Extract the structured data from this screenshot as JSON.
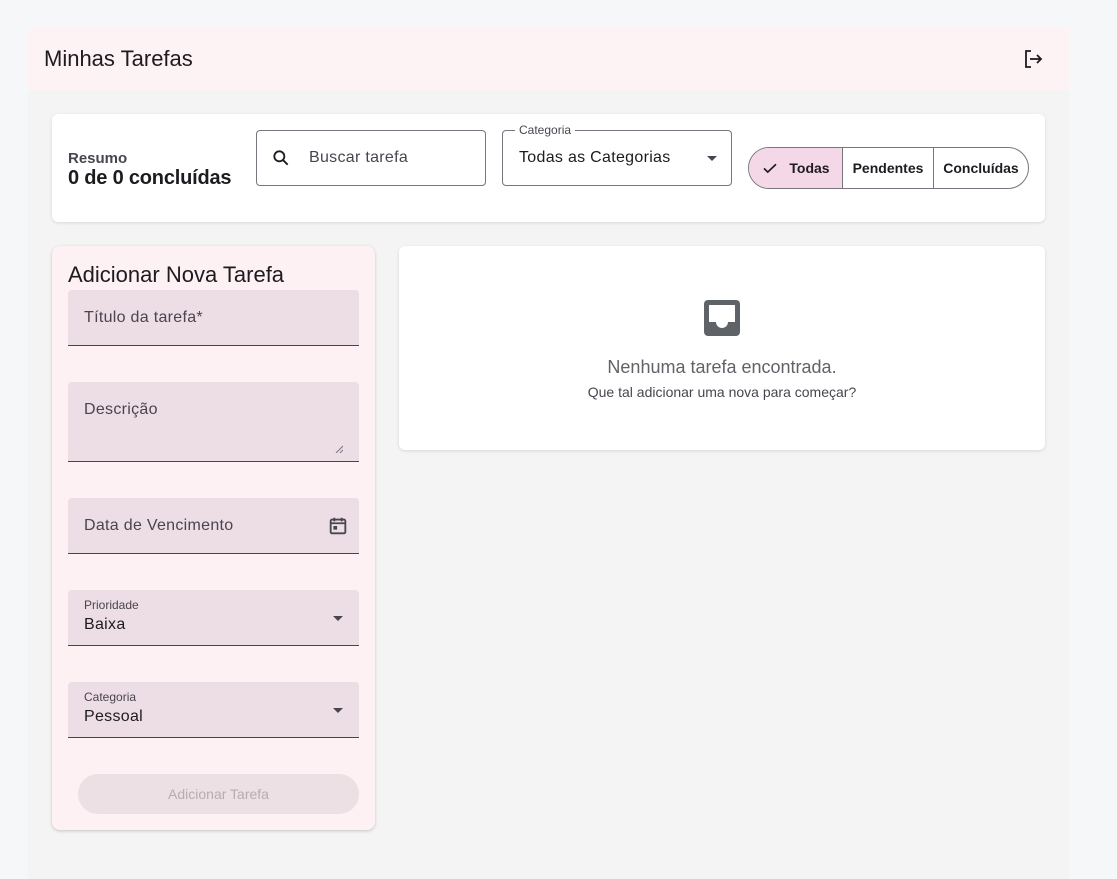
{
  "appbar": {
    "title": "Minhas Tarefas",
    "logout_icon": "logout-icon"
  },
  "summary": {
    "label": "Resumo",
    "value": "0 de 0 concluídas"
  },
  "search": {
    "placeholder": "Buscar tarefa",
    "value": ""
  },
  "category_filter": {
    "label": "Categoria",
    "selected": "Todas as Categorias"
  },
  "status_filter": {
    "options": [
      {
        "label": "Todas",
        "selected": true
      },
      {
        "label": "Pendentes",
        "selected": false
      },
      {
        "label": "Concluídas",
        "selected": false
      }
    ]
  },
  "new_task_form": {
    "title": "Adicionar Nova Tarefa",
    "title_field": {
      "placeholder": "Título da tarefa*"
    },
    "description_field": {
      "placeholder": "Descrição"
    },
    "due_date_field": {
      "placeholder": "Data de Vencimento"
    },
    "priority_field": {
      "label": "Prioridade",
      "value": "Baixa"
    },
    "category_field": {
      "label": "Categoria",
      "value": "Pessoal"
    },
    "submit_label": "Adicionar Tarefa"
  },
  "empty_state": {
    "icon": "inbox-icon",
    "title": "Nenhuma tarefa encontrada.",
    "subtitle": "Que tal adicionar uma nova para começar?"
  },
  "colors": {
    "appbar_bg": "#fdf2f4",
    "segment_active": "#f5d8e8",
    "field_bg": "#eddde5",
    "form_card_bg": "#fdf1f4"
  }
}
